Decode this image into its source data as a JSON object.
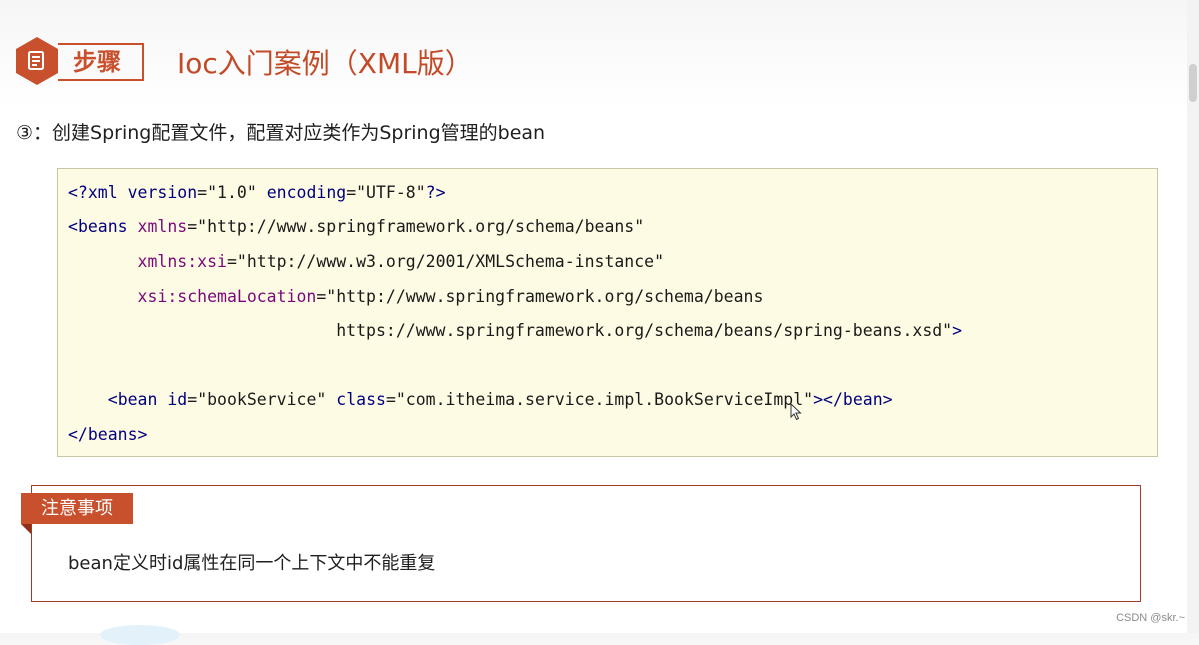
{
  "header": {
    "step_label": "步骤",
    "title": "Ioc入门案例（XML版）"
  },
  "step": {
    "text": "③：创建Spring配置文件，配置对应类作为Spring管理的bean"
  },
  "code": {
    "line1": {
      "open": "<?",
      "tag": "xml",
      "a1": " version",
      "eq1": "=",
      "v1": "\"1.0\"",
      "a2": " encoding",
      "eq2": "=",
      "v2": "\"UTF-8\"",
      "close": "?>"
    },
    "line2": {
      "open": "<",
      "tag": "beans",
      "a1": " xmlns",
      "eq1": "=",
      "v1": "\"http://www.springframework.org/schema/beans\""
    },
    "line3": {
      "indent": "       ",
      "a1": "xmlns:xsi",
      "eq1": "=",
      "v1": "\"http://www.w3.org/2001/XMLSchema-instance\""
    },
    "line4": {
      "indent": "       ",
      "a1": "xsi:schemaLocation",
      "eq1": "=",
      "v1": "\"http://www.springframework.org/schema/beans"
    },
    "line5": {
      "indent": "                           ",
      "v1": "https://www.springframework.org/schema/beans/spring-beans.xsd\"",
      "close": ">"
    },
    "line7": {
      "indent": "    ",
      "open": "<",
      "tag": "bean",
      "a1": " id",
      "eq1": "=",
      "v1": "\"bookService\"",
      "a2": " class",
      "eq2": "=",
      "v2": "\"com.itheima.service.impl.BookServiceImpl\"",
      "mid": "></",
      "tag2": "bean",
      "close": ">"
    },
    "line8": {
      "open": "</",
      "tag": "beans",
      "close": ">"
    }
  },
  "note": {
    "tab_label": "注意事项",
    "text": "bean定义时id属性在同一个上下文中不能重复"
  },
  "watermark": "CSDN @skr.~",
  "colors": {
    "accent": "#c8502c",
    "code_bg": "#fdfbe3",
    "tag": "#00007f",
    "attr": "#7a087a",
    "value": "#0a7a0a"
  },
  "icons": {
    "step_icon": "document-list-icon",
    "cursor": "mouse-pointer-icon"
  }
}
